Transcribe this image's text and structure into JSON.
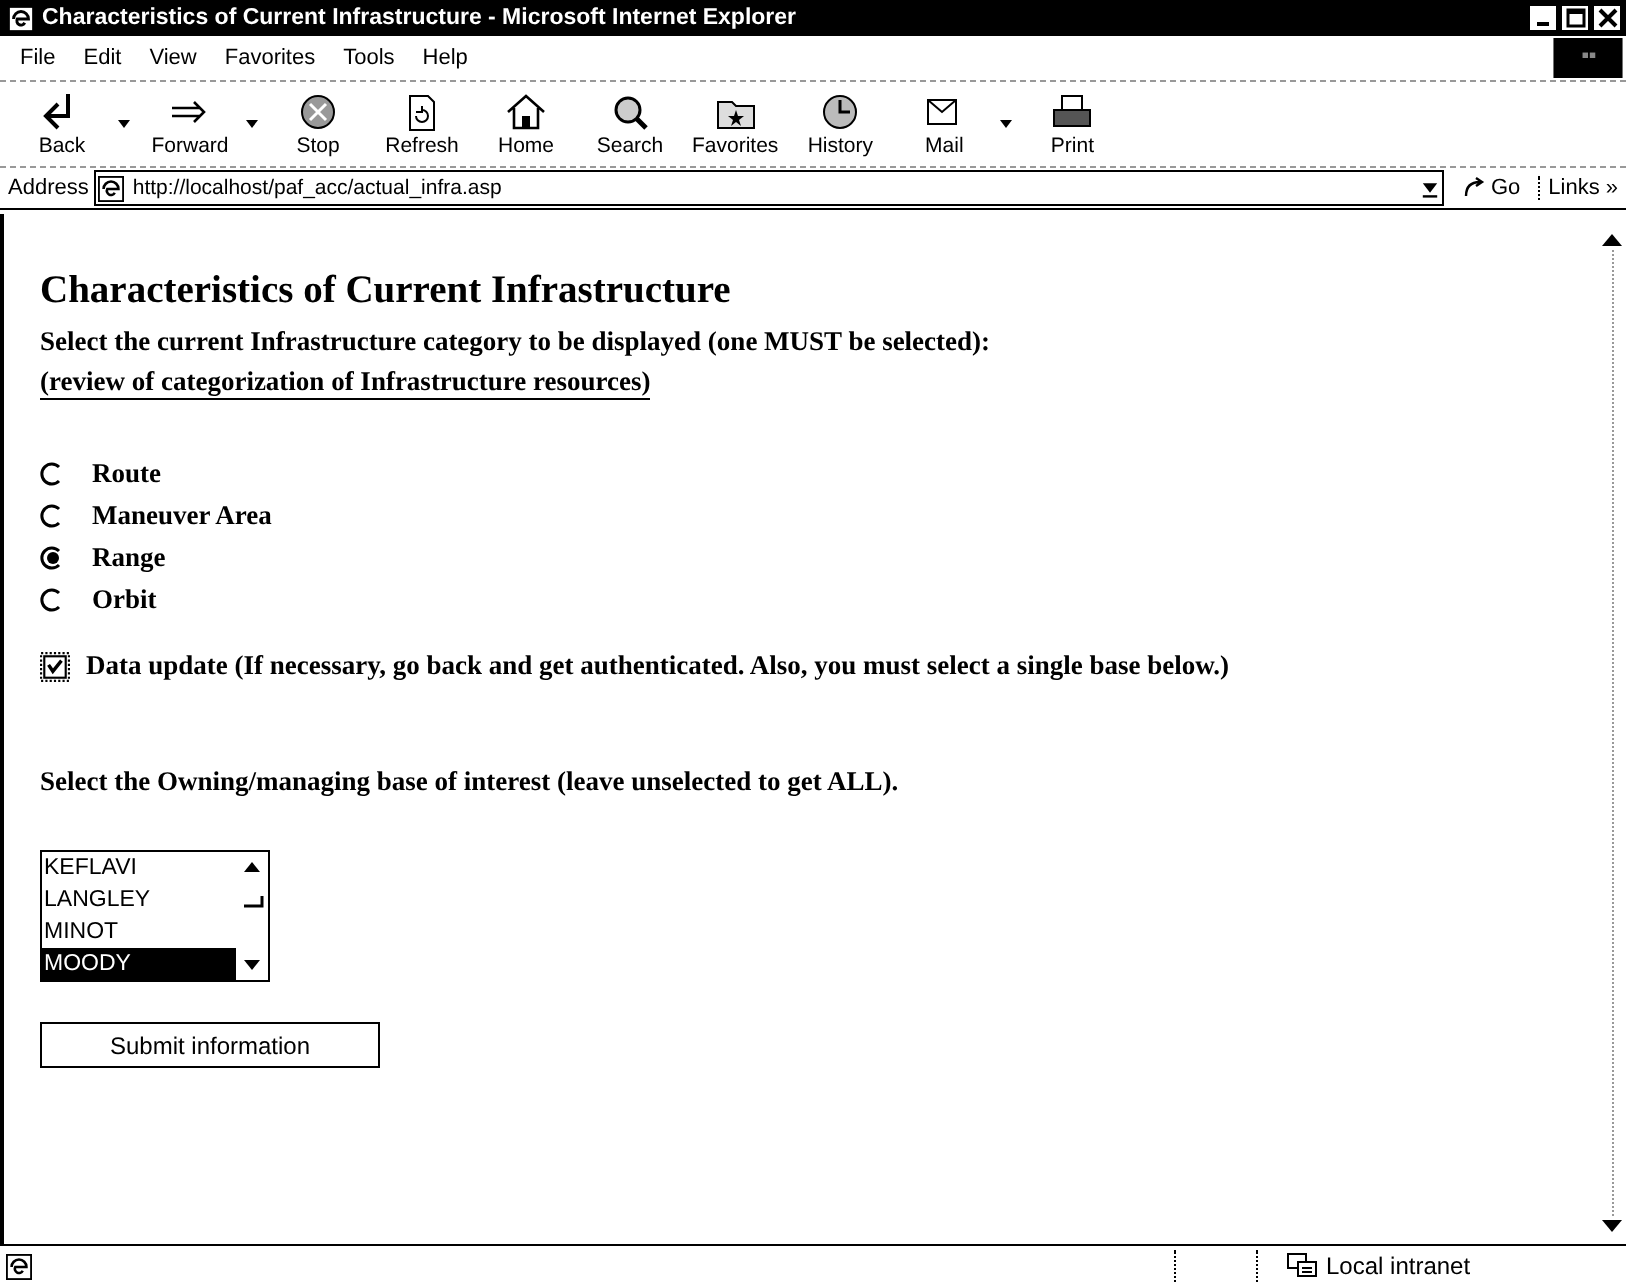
{
  "window": {
    "title": "Characteristics of Current Infrastructure - Microsoft Internet Explorer"
  },
  "menu": [
    "File",
    "Edit",
    "View",
    "Favorites",
    "Tools",
    "Help"
  ],
  "toolbar": [
    {
      "label": "Back",
      "kind": "back",
      "dropdown": true
    },
    {
      "label": "Forward",
      "kind": "forward",
      "dropdown": true
    },
    {
      "label": "Stop",
      "kind": "stop",
      "dropdown": false
    },
    {
      "label": "Refresh",
      "kind": "refresh",
      "dropdown": false
    },
    {
      "label": "Home",
      "kind": "home",
      "dropdown": false
    },
    {
      "label": "Search",
      "kind": "search",
      "dropdown": false
    },
    {
      "label": "Favorites",
      "kind": "favorites",
      "dropdown": false
    },
    {
      "label": "History",
      "kind": "history",
      "dropdown": false
    },
    {
      "label": "Mail",
      "kind": "mail",
      "dropdown": true
    },
    {
      "label": "Print",
      "kind": "print",
      "dropdown": false
    }
  ],
  "address": {
    "label": "Address",
    "value": "http://localhost/paf_acc/actual_infra.asp",
    "go": "Go",
    "links": "Links",
    "links_more": "»"
  },
  "page": {
    "heading": "Characteristics of Current Infrastructure",
    "instruction": "Select the current Infrastructure category to be displayed (one MUST be selected):",
    "link": "(review of categorization of Infrastructure resources)",
    "categories": [
      {
        "label": "Route",
        "selected": false
      },
      {
        "label": "Maneuver Area",
        "selected": false
      },
      {
        "label": "Range",
        "selected": true
      },
      {
        "label": "Orbit",
        "selected": false
      }
    ],
    "data_update": {
      "label": "Data update (If necessary, go back and get authenticated.  Also, you must select a single base below.)",
      "checked": true
    },
    "base_prompt": "Select the Owning/managing base of interest (leave unselected to get ALL).",
    "bases": [
      {
        "label": "KEFLAVI",
        "selected": false
      },
      {
        "label": "LANGLEY",
        "selected": false
      },
      {
        "label": "MINOT",
        "selected": false
      },
      {
        "label": "MOODY",
        "selected": true
      }
    ],
    "submit": "Submit information"
  },
  "status_bar": {
    "zone": "Local intranet"
  }
}
